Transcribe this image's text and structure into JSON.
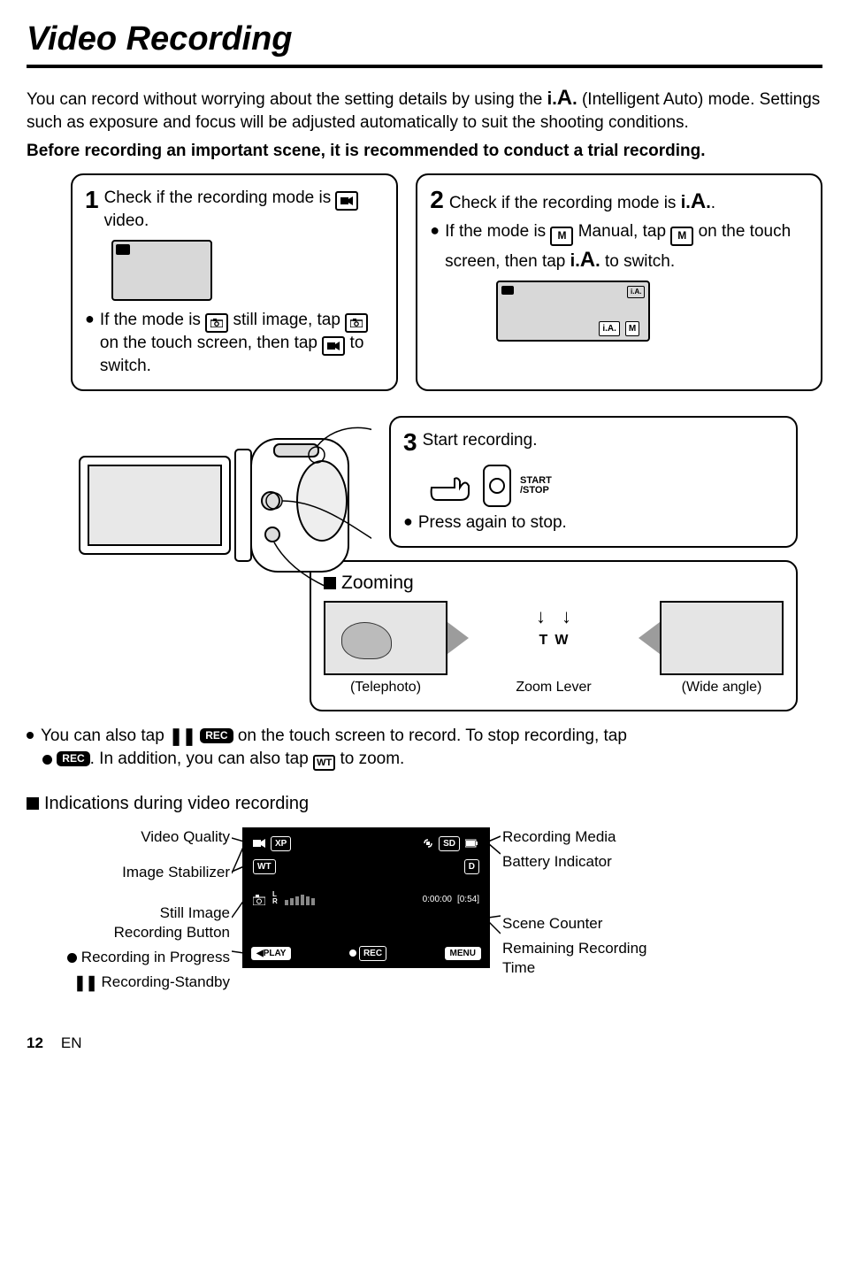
{
  "title": "Video Recording",
  "intro1a": "You can record without worrying about the setting details by using the ",
  "intro1b": " (Intelligent Auto) mode. Settings such as exposure and focus will be adjusted automatically to suit the shooting conditions.",
  "intro2": "Before recording an important scene, it is recommended to conduct a trial recording.",
  "step1": {
    "num": "1",
    "text1": "Check if the recording mode is ",
    "icon1_label": "video-icon",
    "text2": " video.",
    "bullet1a": "If the mode is ",
    "bullet1b": " still image, tap ",
    "bullet1c": " on the touch screen, then tap ",
    "bullet1d": " to switch."
  },
  "step2": {
    "num": "2",
    "text1": "Check if the recording mode is ",
    "text2": ".",
    "bullet1a": "If the mode is ",
    "bullet1b": " Manual, tap ",
    "bullet1c": " on the touch screen, then tap ",
    "bullet1d": " to switch.",
    "boxlabel_ia": "i.A.",
    "boxlabel_m": "M"
  },
  "step3": {
    "num": "3",
    "text1": "Start recording.",
    "ss_top": "START",
    "ss_bot": "/STOP",
    "bullet": "Press again to stop."
  },
  "zoom": {
    "title": "Zooming",
    "t": "T",
    "w": "W",
    "zl": "Zoom Lever",
    "tele": "(Telephoto)",
    "wide": "(Wide angle)"
  },
  "note": {
    "line1a": "You can also tap ",
    "line1b": " on the touch screen to record. To stop recording, tap ",
    "line1c": ". In addition, you can also tap ",
    "line1d": " to zoom.",
    "rec": "REC",
    "rec2": "REC",
    "wt": "WT"
  },
  "indTitle": "Indications during video recording",
  "ind": {
    "left": [
      "Video Quality",
      "Image Stabilizer",
      "Still Image Recording Button",
      "Recording in Progress",
      "Recording-Standby"
    ],
    "right": [
      "Recording Media",
      "Battery Indicator",
      "Scene Counter",
      "Remaining Recording Time"
    ]
  },
  "lcd": {
    "xp": "XP",
    "sd": "SD",
    "wt": "WT",
    "d": "D",
    "lr": "L\nR",
    "time": "0:00:00",
    "remain": "[0:54]",
    "play": "PLAY",
    "rec": "REC",
    "menu": "MENU"
  },
  "footer": {
    "page": "12",
    "lang": "EN"
  }
}
